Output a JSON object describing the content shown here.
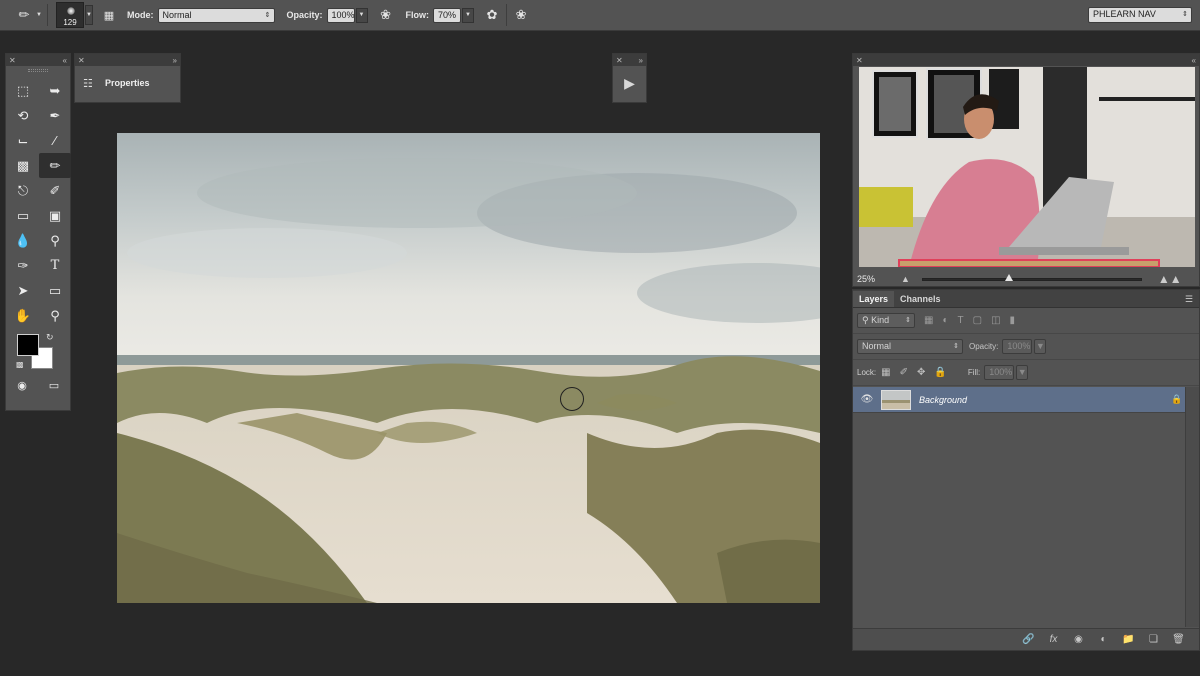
{
  "options_bar": {
    "brush_size": "129",
    "mode_label": "Mode:",
    "mode_value": "Normal",
    "opacity_label": "Opacity:",
    "opacity_value": "100%",
    "flow_label": "Flow:",
    "flow_value": "70%",
    "workspace": "PHLEARN NAV"
  },
  "properties_panel": {
    "title": "Properties"
  },
  "navigator": {
    "zoom": "25%"
  },
  "layers_panel": {
    "tabs": [
      "Layers",
      "Channels"
    ],
    "filter_kind": "Kind",
    "blend_mode": "Normal",
    "opacity_label": "Opacity:",
    "opacity_value": "100%",
    "lock_label": "Lock:",
    "fill_label": "Fill:",
    "fill_value": "100%",
    "layers": [
      {
        "name": "Background",
        "visible": true,
        "locked": true,
        "selected": true
      }
    ]
  },
  "colors": {
    "foreground": "#000000",
    "background": "#ffffff",
    "selected_layer": "#5e6f8a"
  },
  "icons": {
    "tools": [
      "marquee-icon",
      "move-icon",
      "lasso-icon",
      "quick-select-icon",
      "crop-icon",
      "eyedropper-icon",
      "healing-icon",
      "brush-icon",
      "stamp-icon",
      "history-brush-icon",
      "eraser-icon",
      "gradient-icon",
      "blur-icon",
      "dodge-icon",
      "pen-icon",
      "type-icon",
      "path-select-icon",
      "shape-icon",
      "hand-icon",
      "zoom-icon"
    ]
  }
}
